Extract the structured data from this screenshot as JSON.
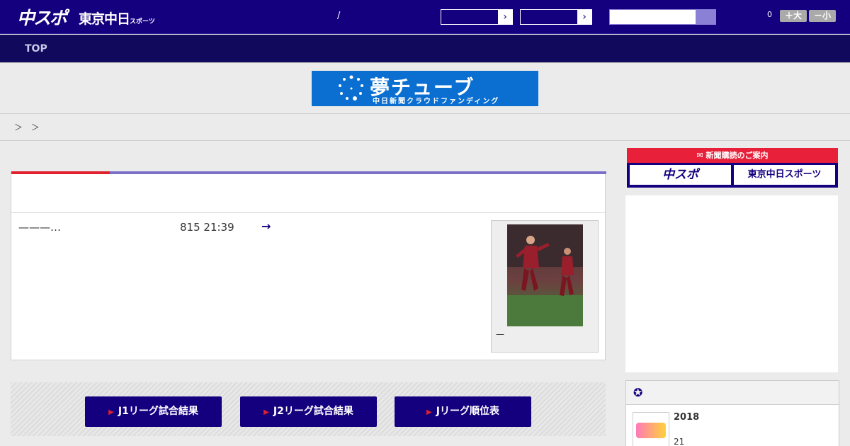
{
  "header": {
    "logo_main": "中スポ",
    "logo_tokyo": "東京中日",
    "logo_tokyo_sub": "スポーツ",
    "slash": "/",
    "select_arrow": "›",
    "font_size_count": "0",
    "zoom_in_label": "＋大",
    "zoom_out_label": "－小"
  },
  "nav": {
    "top_label": "TOP"
  },
  "banner": {
    "title": "夢チューブ",
    "subtitle": "中日新聞クラウドファンディング"
  },
  "breadcrumb": "＞ ＞",
  "article": {
    "lead": "———…",
    "date": "815 21:39",
    "more_arrow": "→",
    "photo_caption": "—"
  },
  "links": [
    {
      "label": "J1リーグ試合結果"
    },
    {
      "label": "J2リーグ試合結果"
    },
    {
      "label": "Jリーグ順位表"
    }
  ],
  "sidebar": {
    "subscribe_header": "新聞購読のご案内",
    "subscribe_chuspo": "中スポ",
    "subscribe_tokyo": "東京中日スポーツ",
    "ranking_item_title": "2018",
    "ranking_item_number": "21"
  },
  "colors": {
    "brand_navy": "#14007f",
    "accent_red": "#e0202c",
    "accent_lavender": "#7b6fc8"
  }
}
